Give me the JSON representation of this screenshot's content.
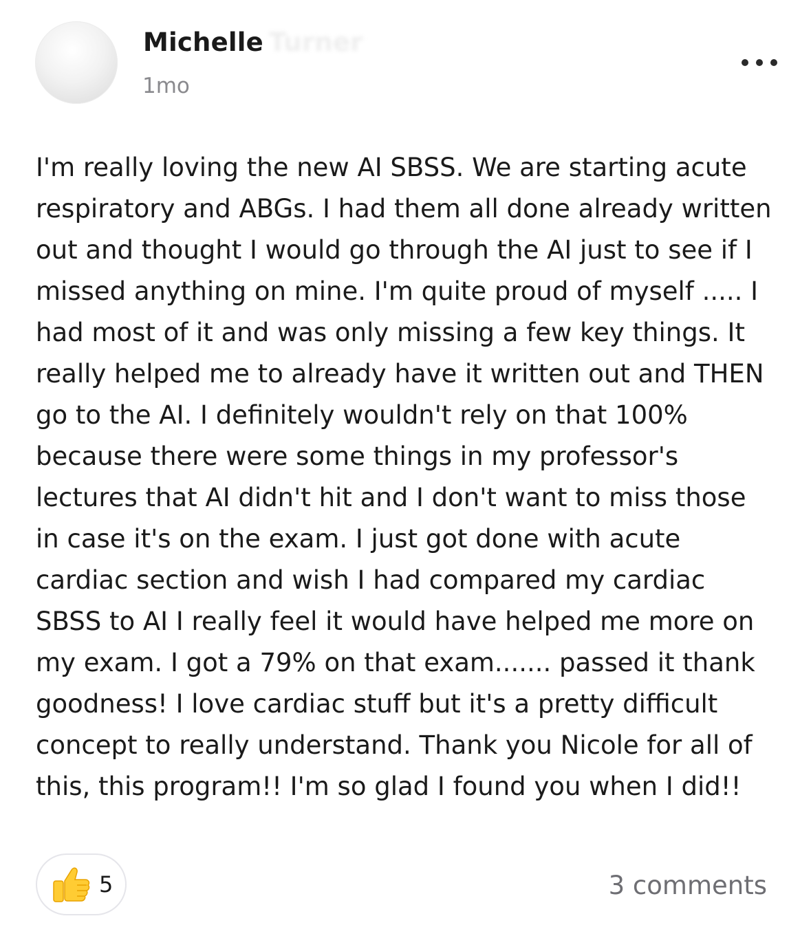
{
  "post": {
    "author_first": "Michelle",
    "author_last": "Turner",
    "timestamp": "1mo",
    "more_icon": "more-horizontal-icon",
    "lines": [
      "I'm really loving the new AI SBSS. We are starting acute",
      "respiratory and ABGs. I had them all done already written",
      "out and thought I would go through the AI just to see if I",
      "missed anything on mine. I'm quite proud of myself  ..... I",
      "had most of it and was only missing a few key things. It",
      "really helped me to already have it written out and THEN",
      "go to the AI. I definitely wouldn't rely on that 100%",
      "because there were some things in my professor's",
      "lectures that AI didn't hit and I don't want to miss those",
      "in case it's on the exam. I just got done with acute",
      "cardiac section and wish I had compared my cardiac",
      "SBSS to AI I really feel it would have helped me more on",
      "my exam. I got a 79% on that exam....... passed it thank",
      "goodness! I love cardiac stuff but it's a pretty difficult",
      "concept to really understand. Thank you Nicole for all of",
      "this, this program!! I'm so glad I found you when I did!!"
    ]
  },
  "footer": {
    "reaction_icon": "thumbs-up-icon",
    "reaction_count": "5",
    "comments_label": "3 comments"
  },
  "colors": {
    "text": "#1a1a1a",
    "muted": "#8a8a8e",
    "comments": "#6e6e73",
    "thumb": "#ffcc33",
    "border": "#e5e5ea"
  }
}
